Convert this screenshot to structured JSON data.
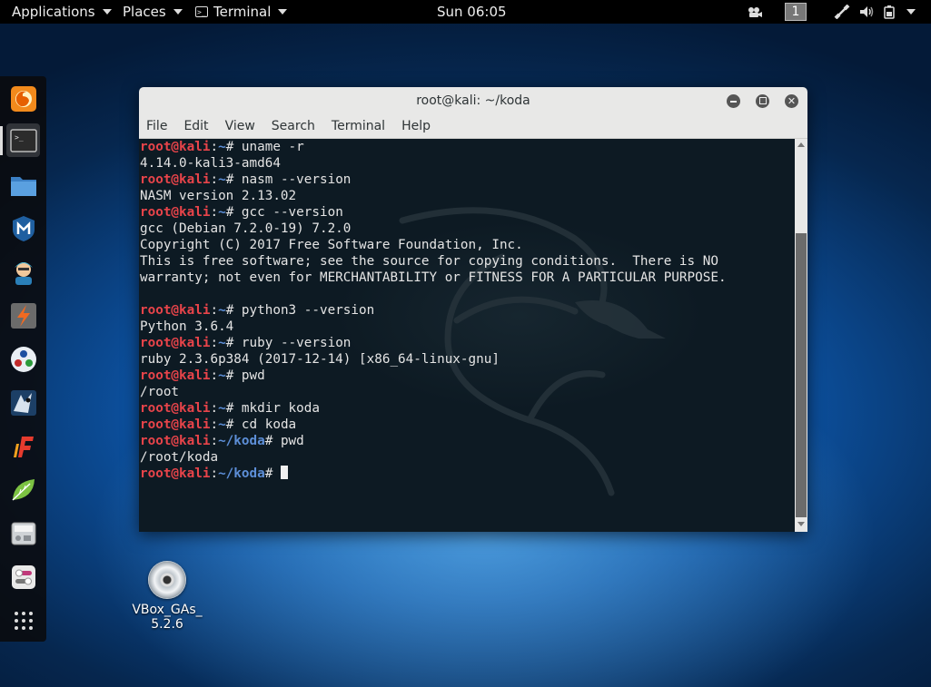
{
  "topbar": {
    "applications": "Applications",
    "places": "Places",
    "terminal": "Terminal",
    "clock": "Sun 06:05",
    "workspace": "1"
  },
  "dock": {
    "items": [
      {
        "name": "firefox-icon"
      },
      {
        "name": "terminal-icon"
      },
      {
        "name": "files-icon"
      },
      {
        "name": "metasploit-icon"
      },
      {
        "name": "armitage-icon"
      },
      {
        "name": "burpsuite-icon"
      },
      {
        "name": "maltego-icon"
      },
      {
        "name": "beef-icon"
      },
      {
        "name": "faraday-icon"
      },
      {
        "name": "leafpad-icon"
      },
      {
        "name": "cherrytree-icon"
      },
      {
        "name": "settings-icon"
      },
      {
        "name": "show-applications-icon"
      }
    ]
  },
  "desktop": {
    "icon_label_1": "VBox_GAs_",
    "icon_label_2": "5.2.6"
  },
  "window": {
    "title": "root@kali: ~/koda",
    "menu": [
      "File",
      "Edit",
      "View",
      "Search",
      "Terminal",
      "Help"
    ]
  },
  "terminal": {
    "lines": [
      {
        "user": "root@kali",
        "path": "~",
        "cmd": "uname -r"
      },
      {
        "out": "4.14.0-kali3-amd64"
      },
      {
        "user": "root@kali",
        "path": "~",
        "cmd": "nasm --version"
      },
      {
        "out": "NASM version 2.13.02"
      },
      {
        "user": "root@kali",
        "path": "~",
        "cmd": "gcc --version"
      },
      {
        "out": "gcc (Debian 7.2.0-19) 7.2.0"
      },
      {
        "out": "Copyright (C) 2017 Free Software Foundation, Inc."
      },
      {
        "out": "This is free software; see the source for copying conditions.  There is NO"
      },
      {
        "out": "warranty; not even for MERCHANTABILITY or FITNESS FOR A PARTICULAR PURPOSE."
      },
      {
        "out": ""
      },
      {
        "user": "root@kali",
        "path": "~",
        "cmd": "python3 --version"
      },
      {
        "out": "Python 3.6.4"
      },
      {
        "user": "root@kali",
        "path": "~",
        "cmd": "ruby --version"
      },
      {
        "out": "ruby 2.3.6p384 (2017-12-14) [x86_64-linux-gnu]"
      },
      {
        "user": "root@kali",
        "path": "~",
        "cmd": "pwd"
      },
      {
        "out": "/root"
      },
      {
        "user": "root@kali",
        "path": "~",
        "cmd": "mkdir koda"
      },
      {
        "user": "root@kali",
        "path": "~",
        "cmd": "cd koda"
      },
      {
        "user": "root@kali",
        "path": "~/koda",
        "cmd": "pwd"
      },
      {
        "out": "/root/koda"
      },
      {
        "user": "root@kali",
        "path": "~/koda",
        "cmd": "",
        "cursor": true
      }
    ]
  }
}
